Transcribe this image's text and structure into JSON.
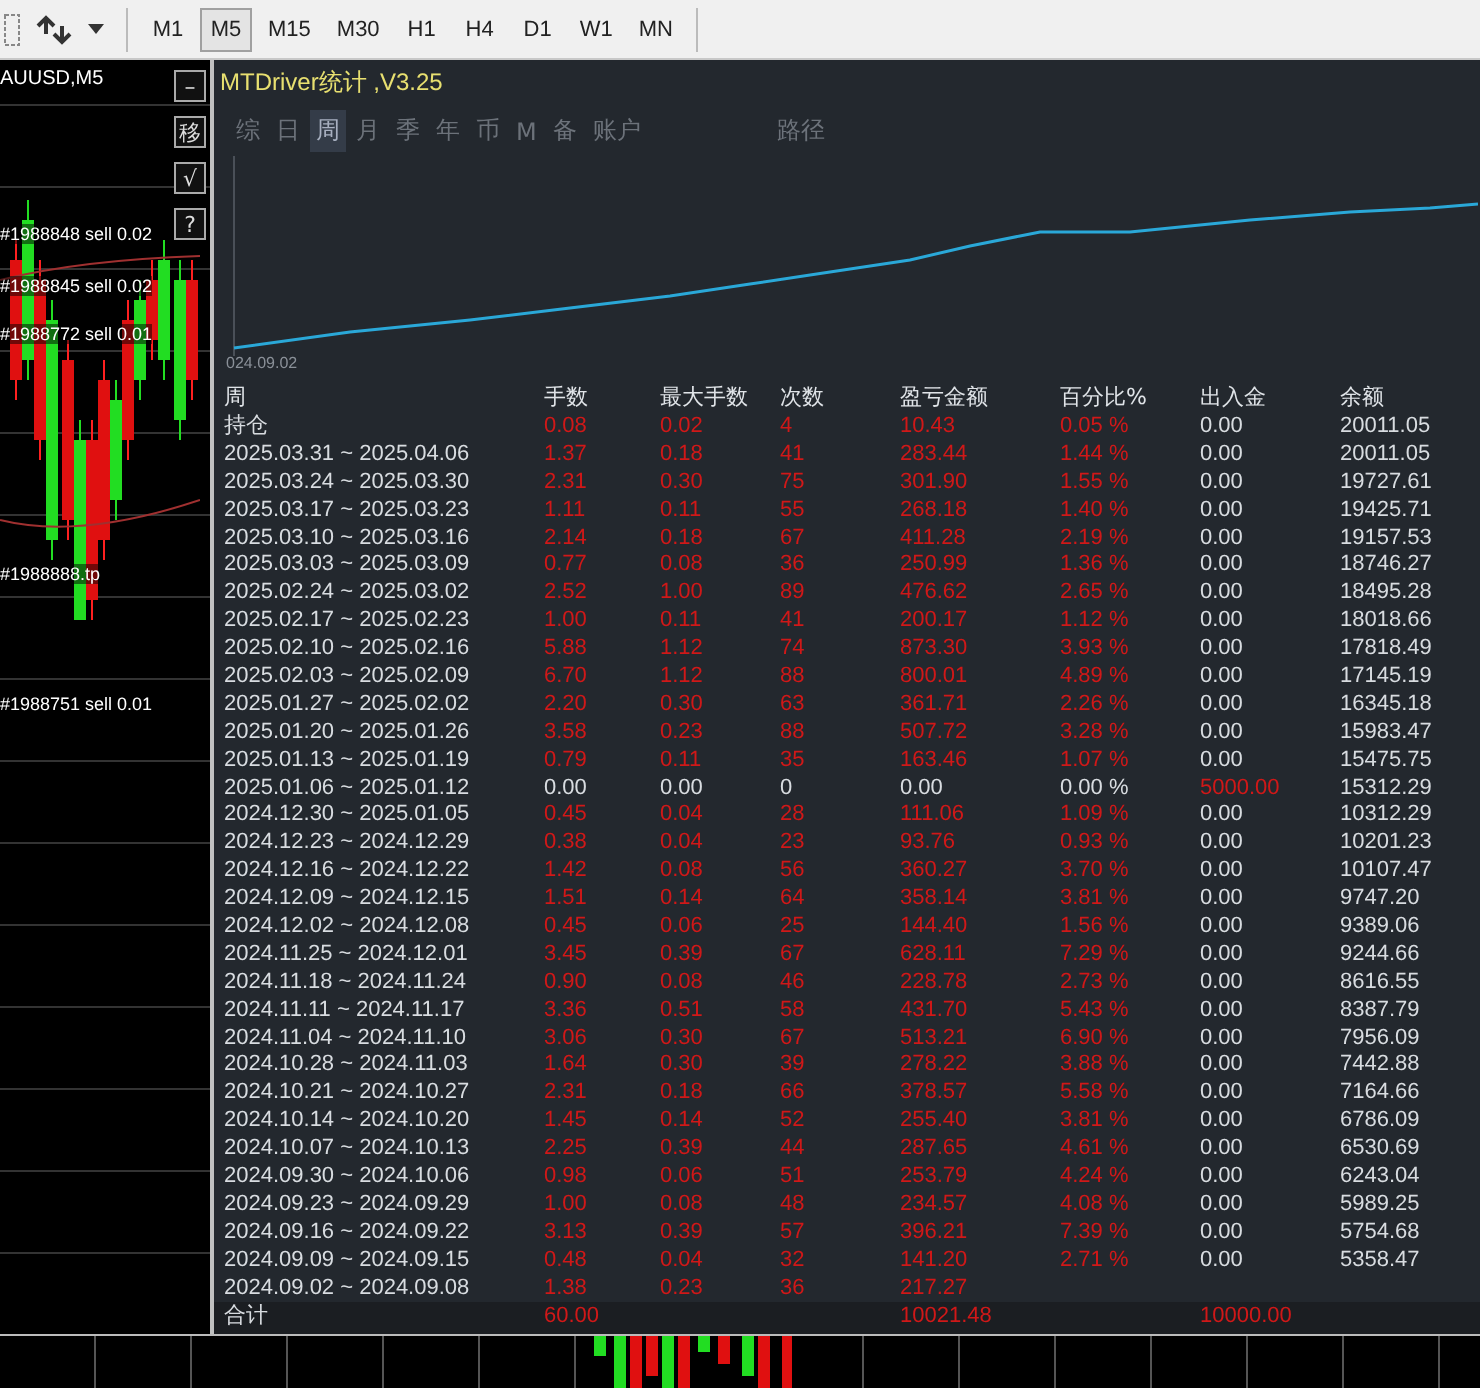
{
  "toolbar": {
    "timeframes": [
      {
        "label": "M1",
        "selected": false
      },
      {
        "label": "M5",
        "selected": true
      },
      {
        "label": "M15",
        "selected": false
      },
      {
        "label": "M30",
        "selected": false
      },
      {
        "label": "H1",
        "selected": false
      },
      {
        "label": "H4",
        "selected": false
      },
      {
        "label": "D1",
        "selected": false
      },
      {
        "label": "W1",
        "selected": false
      },
      {
        "label": "MN",
        "selected": false
      }
    ]
  },
  "price_chart": {
    "symbol": "AUUSD,M5",
    "buttons": [
      "–",
      "移",
      "√",
      "?"
    ],
    "order_labels": [
      "#1988848 sell 0.02",
      "#1988845 sell 0.02",
      "#1988772 sell 0.01",
      "#1988888.tp",
      "#1988751 sell 0.01"
    ]
  },
  "panel": {
    "title": "MTDriver统计 ,V3.25",
    "tabs": [
      {
        "label": "综",
        "selected": false
      },
      {
        "label": "日",
        "selected": false
      },
      {
        "label": "周",
        "selected": true
      },
      {
        "label": "月",
        "selected": false
      },
      {
        "label": "季",
        "selected": false
      },
      {
        "label": "年",
        "selected": false
      },
      {
        "label": "币",
        "selected": false
      },
      {
        "label": "M",
        "selected": false
      },
      {
        "label": "备",
        "selected": false
      },
      {
        "label": "账户",
        "selected": false
      },
      {
        "label": "路径",
        "selected": false
      }
    ],
    "equity_chart": {
      "start_label": "024.09.02"
    },
    "table": {
      "columns": [
        "周",
        "手数",
        "最大手数",
        "次数",
        "盈亏金额",
        "百分比%",
        "出入金",
        "余额"
      ],
      "rows": [
        {
          "period": "持仓",
          "lots": "0.08",
          "max_lots": "0.02",
          "count": "4",
          "pnl": "10.43",
          "pct": "0.05 %",
          "deposit": "0.00",
          "balance": "20011.05",
          "red": true
        },
        {
          "period": "2025.03.31 ~ 2025.04.06",
          "lots": "1.37",
          "max_lots": "0.18",
          "count": "41",
          "pnl": "283.44",
          "pct": "1.44 %",
          "deposit": "0.00",
          "balance": "20011.05",
          "red": true
        },
        {
          "period": "2025.03.24 ~ 2025.03.30",
          "lots": "2.31",
          "max_lots": "0.30",
          "count": "75",
          "pnl": "301.90",
          "pct": "1.55 %",
          "deposit": "0.00",
          "balance": "19727.61",
          "red": true
        },
        {
          "period": "2025.03.17 ~ 2025.03.23",
          "lots": "1.11",
          "max_lots": "0.11",
          "count": "55",
          "pnl": "268.18",
          "pct": "1.40 %",
          "deposit": "0.00",
          "balance": "19425.71",
          "red": true
        },
        {
          "period": "2025.03.10 ~ 2025.03.16",
          "lots": "2.14",
          "max_lots": "0.18",
          "count": "67",
          "pnl": "411.28",
          "pct": "2.19 %",
          "deposit": "0.00",
          "balance": "19157.53",
          "red": true
        },
        {
          "period": "2025.03.03 ~ 2025.03.09",
          "lots": "0.77",
          "max_lots": "0.08",
          "count": "36",
          "pnl": "250.99",
          "pct": "1.36 %",
          "deposit": "0.00",
          "balance": "18746.27",
          "red": true
        },
        {
          "period": "2025.02.24 ~ 2025.03.02",
          "lots": "2.52",
          "max_lots": "1.00",
          "count": "89",
          "pnl": "476.62",
          "pct": "2.65 %",
          "deposit": "0.00",
          "balance": "18495.28",
          "red": true
        },
        {
          "period": "2025.02.17 ~ 2025.02.23",
          "lots": "1.00",
          "max_lots": "0.11",
          "count": "41",
          "pnl": "200.17",
          "pct": "1.12 %",
          "deposit": "0.00",
          "balance": "18018.66",
          "red": true
        },
        {
          "period": "2025.02.10 ~ 2025.02.16",
          "lots": "5.88",
          "max_lots": "1.12",
          "count": "74",
          "pnl": "873.30",
          "pct": "3.93 %",
          "deposit": "0.00",
          "balance": "17818.49",
          "red": true
        },
        {
          "period": "2025.02.03 ~ 2025.02.09",
          "lots": "6.70",
          "max_lots": "1.12",
          "count": "88",
          "pnl": "800.01",
          "pct": "4.89 %",
          "deposit": "0.00",
          "balance": "17145.19",
          "red": true
        },
        {
          "period": "2025.01.27 ~ 2025.02.02",
          "lots": "2.20",
          "max_lots": "0.30",
          "count": "63",
          "pnl": "361.71",
          "pct": "2.26 %",
          "deposit": "0.00",
          "balance": "16345.18",
          "red": true
        },
        {
          "period": "2025.01.20 ~ 2025.01.26",
          "lots": "3.58",
          "max_lots": "0.23",
          "count": "88",
          "pnl": "507.72",
          "pct": "3.28 %",
          "deposit": "0.00",
          "balance": "15983.47",
          "red": true
        },
        {
          "period": "2025.01.13 ~ 2025.01.19",
          "lots": "0.79",
          "max_lots": "0.11",
          "count": "35",
          "pnl": "163.46",
          "pct": "1.07 %",
          "deposit": "0.00",
          "balance": "15475.75",
          "red": true
        },
        {
          "period": "2025.01.06 ~ 2025.01.12",
          "lots": "0.00",
          "max_lots": "0.00",
          "count": "0",
          "pnl": "0.00",
          "pct": "0.00 %",
          "deposit": "5000.00",
          "balance": "15312.29",
          "red": false,
          "deposit_red": true
        },
        {
          "period": "2024.12.30 ~ 2025.01.05",
          "lots": "0.45",
          "max_lots": "0.04",
          "count": "28",
          "pnl": "111.06",
          "pct": "1.09 %",
          "deposit": "0.00",
          "balance": "10312.29",
          "red": true
        },
        {
          "period": "2024.12.23 ~ 2024.12.29",
          "lots": "0.38",
          "max_lots": "0.04",
          "count": "23",
          "pnl": "93.76",
          "pct": "0.93 %",
          "deposit": "0.00",
          "balance": "10201.23",
          "red": true
        },
        {
          "period": "2024.12.16 ~ 2024.12.22",
          "lots": "1.42",
          "max_lots": "0.08",
          "count": "56",
          "pnl": "360.27",
          "pct": "3.70 %",
          "deposit": "0.00",
          "balance": "10107.47",
          "red": true
        },
        {
          "period": "2024.12.09 ~ 2024.12.15",
          "lots": "1.51",
          "max_lots": "0.14",
          "count": "64",
          "pnl": "358.14",
          "pct": "3.81 %",
          "deposit": "0.00",
          "balance": "9747.20",
          "red": true
        },
        {
          "period": "2024.12.02 ~ 2024.12.08",
          "lots": "0.45",
          "max_lots": "0.06",
          "count": "25",
          "pnl": "144.40",
          "pct": "1.56 %",
          "deposit": "0.00",
          "balance": "9389.06",
          "red": true
        },
        {
          "period": "2024.11.25 ~ 2024.12.01",
          "lots": "3.45",
          "max_lots": "0.39",
          "count": "67",
          "pnl": "628.11",
          "pct": "7.29 %",
          "deposit": "0.00",
          "balance": "9244.66",
          "red": true
        },
        {
          "period": "2024.11.18 ~ 2024.11.24",
          "lots": "0.90",
          "max_lots": "0.08",
          "count": "46",
          "pnl": "228.78",
          "pct": "2.73 %",
          "deposit": "0.00",
          "balance": "8616.55",
          "red": true
        },
        {
          "period": "2024.11.11 ~ 2024.11.17",
          "lots": "3.36",
          "max_lots": "0.51",
          "count": "58",
          "pnl": "431.70",
          "pct": "5.43 %",
          "deposit": "0.00",
          "balance": "8387.79",
          "red": true
        },
        {
          "period": "2024.11.04 ~ 2024.11.10",
          "lots": "3.06",
          "max_lots": "0.30",
          "count": "67",
          "pnl": "513.21",
          "pct": "6.90 %",
          "deposit": "0.00",
          "balance": "7956.09",
          "red": true
        },
        {
          "period": "2024.10.28 ~ 2024.11.03",
          "lots": "1.64",
          "max_lots": "0.30",
          "count": "39",
          "pnl": "278.22",
          "pct": "3.88 %",
          "deposit": "0.00",
          "balance": "7442.88",
          "red": true
        },
        {
          "period": "2024.10.21 ~ 2024.10.27",
          "lots": "2.31",
          "max_lots": "0.18",
          "count": "66",
          "pnl": "378.57",
          "pct": "5.58 %",
          "deposit": "0.00",
          "balance": "7164.66",
          "red": true
        },
        {
          "period": "2024.10.14 ~ 2024.10.20",
          "lots": "1.45",
          "max_lots": "0.14",
          "count": "52",
          "pnl": "255.40",
          "pct": "3.81 %",
          "deposit": "0.00",
          "balance": "6786.09",
          "red": true
        },
        {
          "period": "2024.10.07 ~ 2024.10.13",
          "lots": "2.25",
          "max_lots": "0.39",
          "count": "44",
          "pnl": "287.65",
          "pct": "4.61 %",
          "deposit": "0.00",
          "balance": "6530.69",
          "red": true
        },
        {
          "period": "2024.09.30 ~ 2024.10.06",
          "lots": "0.98",
          "max_lots": "0.06",
          "count": "51",
          "pnl": "253.79",
          "pct": "4.24 %",
          "deposit": "0.00",
          "balance": "6243.04",
          "red": true
        },
        {
          "period": "2024.09.23 ~ 2024.09.29",
          "lots": "1.00",
          "max_lots": "0.08",
          "count": "48",
          "pnl": "234.57",
          "pct": "4.08 %",
          "deposit": "0.00",
          "balance": "5989.25",
          "red": true
        },
        {
          "period": "2024.09.16 ~ 2024.09.22",
          "lots": "3.13",
          "max_lots": "0.39",
          "count": "57",
          "pnl": "396.21",
          "pct": "7.39 %",
          "deposit": "0.00",
          "balance": "5754.68",
          "red": true
        },
        {
          "period": "2024.09.09 ~ 2024.09.15",
          "lots": "0.48",
          "max_lots": "0.04",
          "count": "32",
          "pnl": "141.20",
          "pct": "2.71 %",
          "deposit": "0.00",
          "balance": "5358.47",
          "red": true
        },
        {
          "period": "2024.09.02 ~ 2024.09.08",
          "lots": "1.38",
          "max_lots": "0.23",
          "count": "36",
          "pnl": "217.27",
          "red": true
        }
      ],
      "total": {
        "period": "合计",
        "lots": "60.00",
        "pnl": "10021.48",
        "deposit": "10000.00",
        "red": true,
        "deposit_red": true
      }
    }
  }
}
